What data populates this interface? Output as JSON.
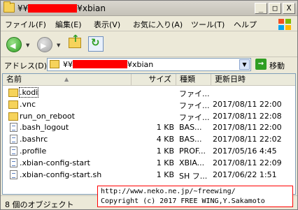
{
  "window": {
    "title_prefix": "¥¥",
    "title_suffix": "¥xbian",
    "buttons": [
      "_",
      "□",
      "X"
    ]
  },
  "menu": [
    "ファイル(F)",
    "編集(E)",
    "表示(V)",
    "お気に入り(A)",
    "ツール(T)",
    "ヘルプ"
  ],
  "toolbar": {
    "back_icon": "back-arrow-icon",
    "forward_icon": "forward-arrow-icon",
    "up_icon": "folder-up-icon",
    "refresh_icon": "refresh-icon"
  },
  "address": {
    "label": "アドレス(D)",
    "prefix": "¥¥",
    "suffix": "¥xbian",
    "go_label": "移動"
  },
  "columns": {
    "name": "名前",
    "sort_indicator": "▲",
    "size": "サイズ",
    "type": "種類",
    "date": "更新日時"
  },
  "files": [
    {
      "name": ".kodi",
      "size": "",
      "type": "ファイ...",
      "date": "",
      "icon": "folder"
    },
    {
      "name": ".vnc",
      "size": "",
      "type": "ファイ...",
      "date": "2017/08/11 22:00",
      "icon": "folder"
    },
    {
      "name": "run_on_reboot",
      "size": "",
      "type": "ファイ...",
      "date": "2017/08/11 22:08",
      "icon": "folder"
    },
    {
      "name": ".bash_logout",
      "size": "1 KB",
      "type": "BAS...",
      "date": "2017/08/11 22:00",
      "icon": "file"
    },
    {
      "name": ".bashrc",
      "size": "4 KB",
      "type": "BAS...",
      "date": "2017/08/11 22:02",
      "icon": "file"
    },
    {
      "name": ".profile",
      "size": "1 KB",
      "type": "PROF...",
      "date": "2017/05/16 4:45",
      "icon": "file"
    },
    {
      "name": ".xbian-config-start",
      "size": "1 KB",
      "type": "XBIA...",
      "date": "2017/08/11 22:09",
      "icon": "file"
    },
    {
      "name": ".xbian-config-start.sh",
      "size": "1 KB",
      "type": "SH フ...",
      "date": "2017/06/22 1:51",
      "icon": "file"
    }
  ],
  "status": {
    "text": "8 個のオブジェクト"
  },
  "credit": {
    "line1": "http://www.neko.ne.jp/~freewing/",
    "line2": "Copyright (c) 2017 FREE WING,Y.Sakamoto"
  },
  "colors": {
    "redaction": "#ff0000",
    "window_bg": "#ece9d8",
    "credit_border": "#ff0000"
  }
}
